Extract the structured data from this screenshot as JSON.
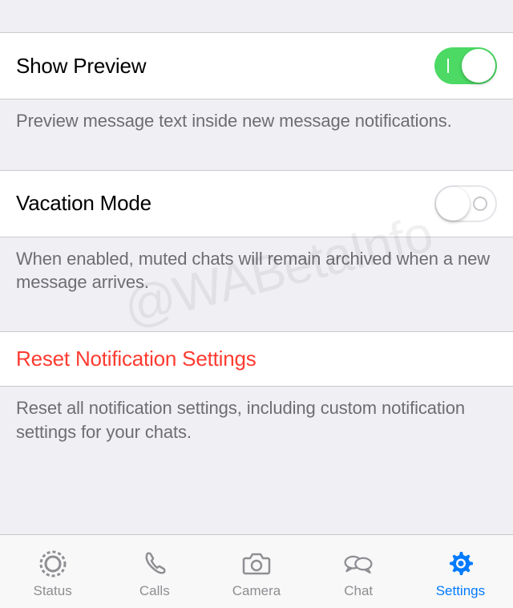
{
  "watermark": "@WABetaInfo",
  "sections": {
    "preview": {
      "title": "Show Preview",
      "enabled": true,
      "description": "Preview message text inside new message notifications."
    },
    "vacation": {
      "title": "Vacation Mode",
      "enabled": false,
      "description": "When enabled, muted chats will remain archived when a new message arrives."
    },
    "reset": {
      "title": "Reset Notification Settings",
      "description": "Reset all notification settings, including custom notification settings for your chats."
    }
  },
  "tabs": {
    "status": "Status",
    "calls": "Calls",
    "camera": "Camera",
    "chat": "Chat",
    "settings": "Settings",
    "active": "settings"
  }
}
